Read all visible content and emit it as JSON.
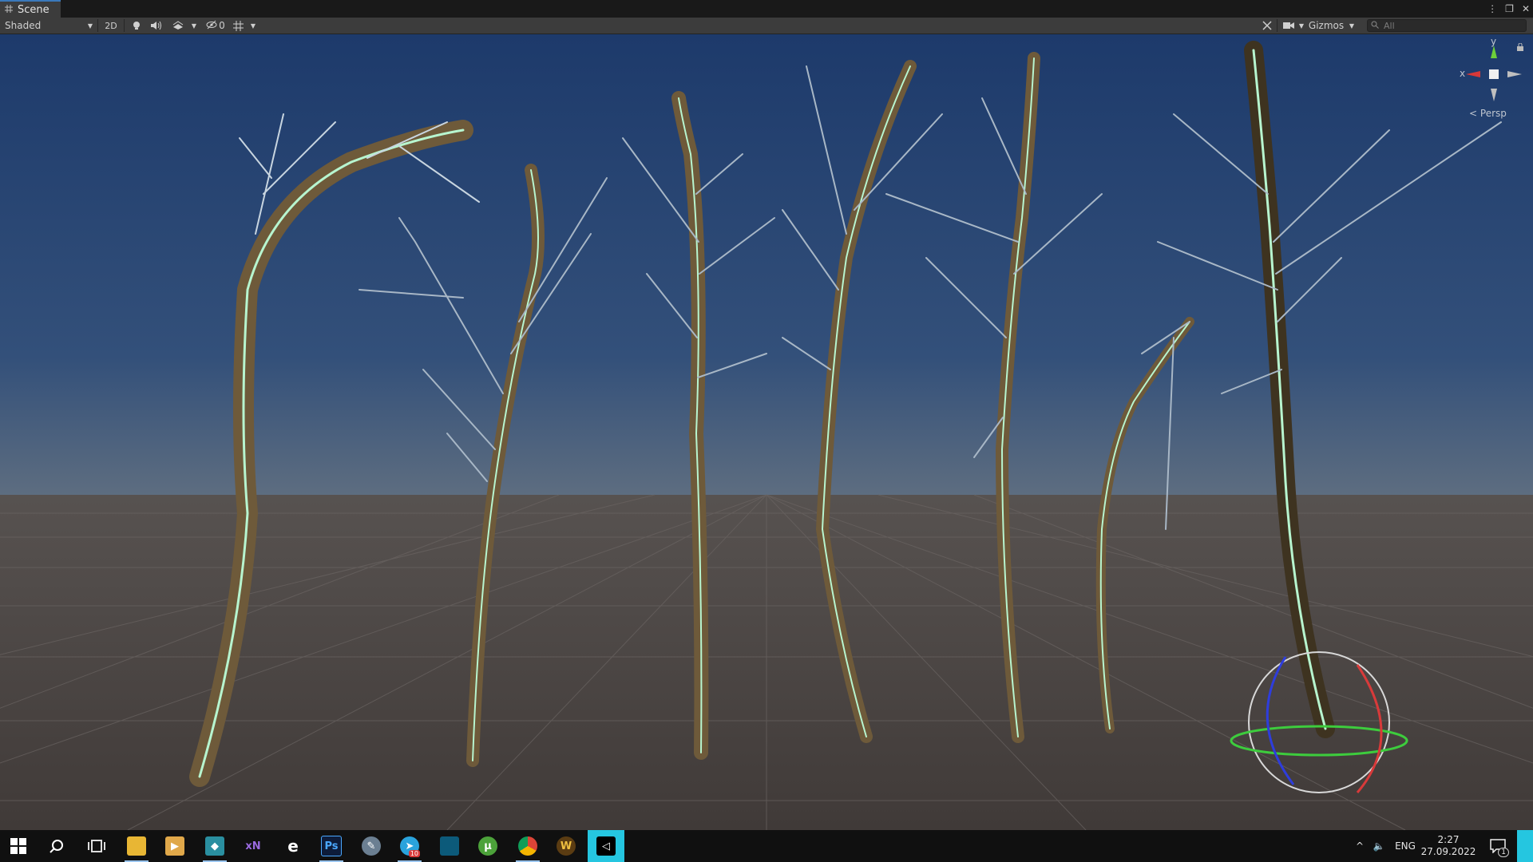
{
  "tab": {
    "label": "Scene",
    "icon": "scene-grid-icon"
  },
  "window_controls": [
    "more-icon",
    "maximize-icon",
    "close-icon"
  ],
  "toolbar": {
    "draw_mode": "Shaded",
    "toggle_2d": "2D",
    "hidden_count": "0",
    "gizmos_label": "Gizmos",
    "search_placeholder": "All"
  },
  "orientation_gizmo": {
    "x_label": "x",
    "y_label": "y",
    "projection": "Persp"
  },
  "taskbar": {
    "apps": [
      "start-icon",
      "search-icon",
      "task-view-icon",
      "file-explorer-icon",
      "media-player-icon",
      "3d-app-icon",
      "xnview-icon",
      "edge-icon",
      "photoshop-icon",
      "paint-icon",
      "telegram-icon",
      "ps-alt-icon",
      "utorrent-icon",
      "chrome-icon",
      "warcraft-icon",
      "unity-icon"
    ],
    "photoshop_label": "Ps",
    "xn_label": "xN",
    "edge_label": "e",
    "wow_label": "W",
    "telegram_badge": "10",
    "language": "ENG",
    "time": "2:27",
    "date": "27.09.2022",
    "notification_count": "1"
  },
  "colors": {
    "accent": "#3a79bb",
    "sky_top": "#1d3a6b",
    "ground": "#4a4543",
    "outline": "#a8f0c8"
  }
}
